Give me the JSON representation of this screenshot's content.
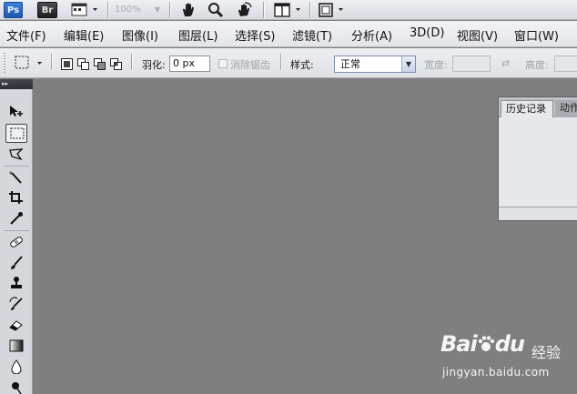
{
  "app_bar": {
    "ps_logo": "Ps",
    "bridge_logo": "Br",
    "zoom_level": "100%"
  },
  "menu": [
    {
      "label": "文件(F)",
      "name": "menu-file"
    },
    {
      "label": "编辑(E)",
      "name": "menu-edit"
    },
    {
      "label": "图像(I)",
      "name": "menu-image"
    },
    {
      "label": "图层(L)",
      "name": "menu-layer"
    },
    {
      "label": "选择(S)",
      "name": "menu-select"
    },
    {
      "label": "滤镜(T)",
      "name": "menu-filter"
    },
    {
      "label": "分析(A)",
      "name": "menu-analysis"
    },
    {
      "label": "3D(D)",
      "name": "menu-3d"
    },
    {
      "label": "视图(V)",
      "name": "menu-view"
    },
    {
      "label": "窗口(W)",
      "name": "menu-window"
    }
  ],
  "options": {
    "feather_label": "羽化:",
    "feather_value": "0 px",
    "antialias_label": "消除锯齿",
    "style_label": "样式:",
    "style_value": "正常",
    "width_label": "宽度:",
    "height_label": "高度:"
  },
  "panel": {
    "tab_history": "历史记录",
    "tab_actions": "动作"
  },
  "watermark": {
    "logo": "Bai",
    "logo2": "du",
    "jingyan": "经验",
    "url": "jingyan.baidu.com"
  },
  "colors": {
    "canvas_bg": "#7f7f7f",
    "ps_blue": "#2a6cc8"
  }
}
